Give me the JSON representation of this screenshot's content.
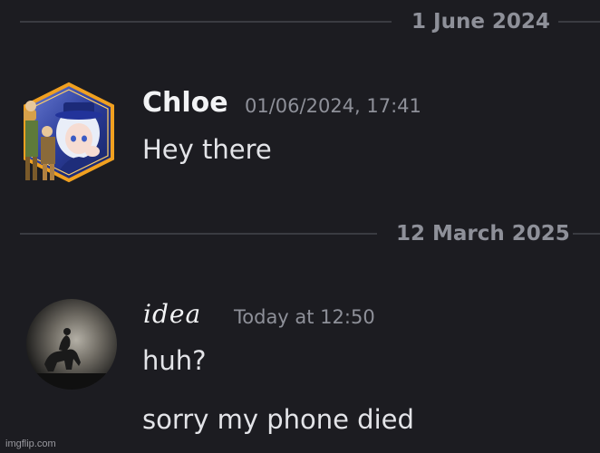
{
  "dividers": [
    {
      "date": "1 June 2024"
    },
    {
      "date": "12 March 2025"
    }
  ],
  "messages": [
    {
      "username": "Chloe",
      "timestamp": "01/06/2024, 17:41",
      "lines": [
        "Hey there"
      ],
      "avatar": "chloe-avatar"
    },
    {
      "username": "𝑖𝑑𝑒𝑎",
      "timestamp": "Today at 12:50",
      "lines": [
        "huh?",
        "sorry my phone died"
      ],
      "avatar": "idea-avatar"
    }
  ],
  "watermark": "imgflip.com",
  "colors": {
    "background": "#1c1c21",
    "divider_line": "#3a3b41",
    "muted_text": "#8e9099",
    "username": "#f2f3f5",
    "message_text": "#e3e4e8",
    "avatar_frame": "#f0a020"
  }
}
